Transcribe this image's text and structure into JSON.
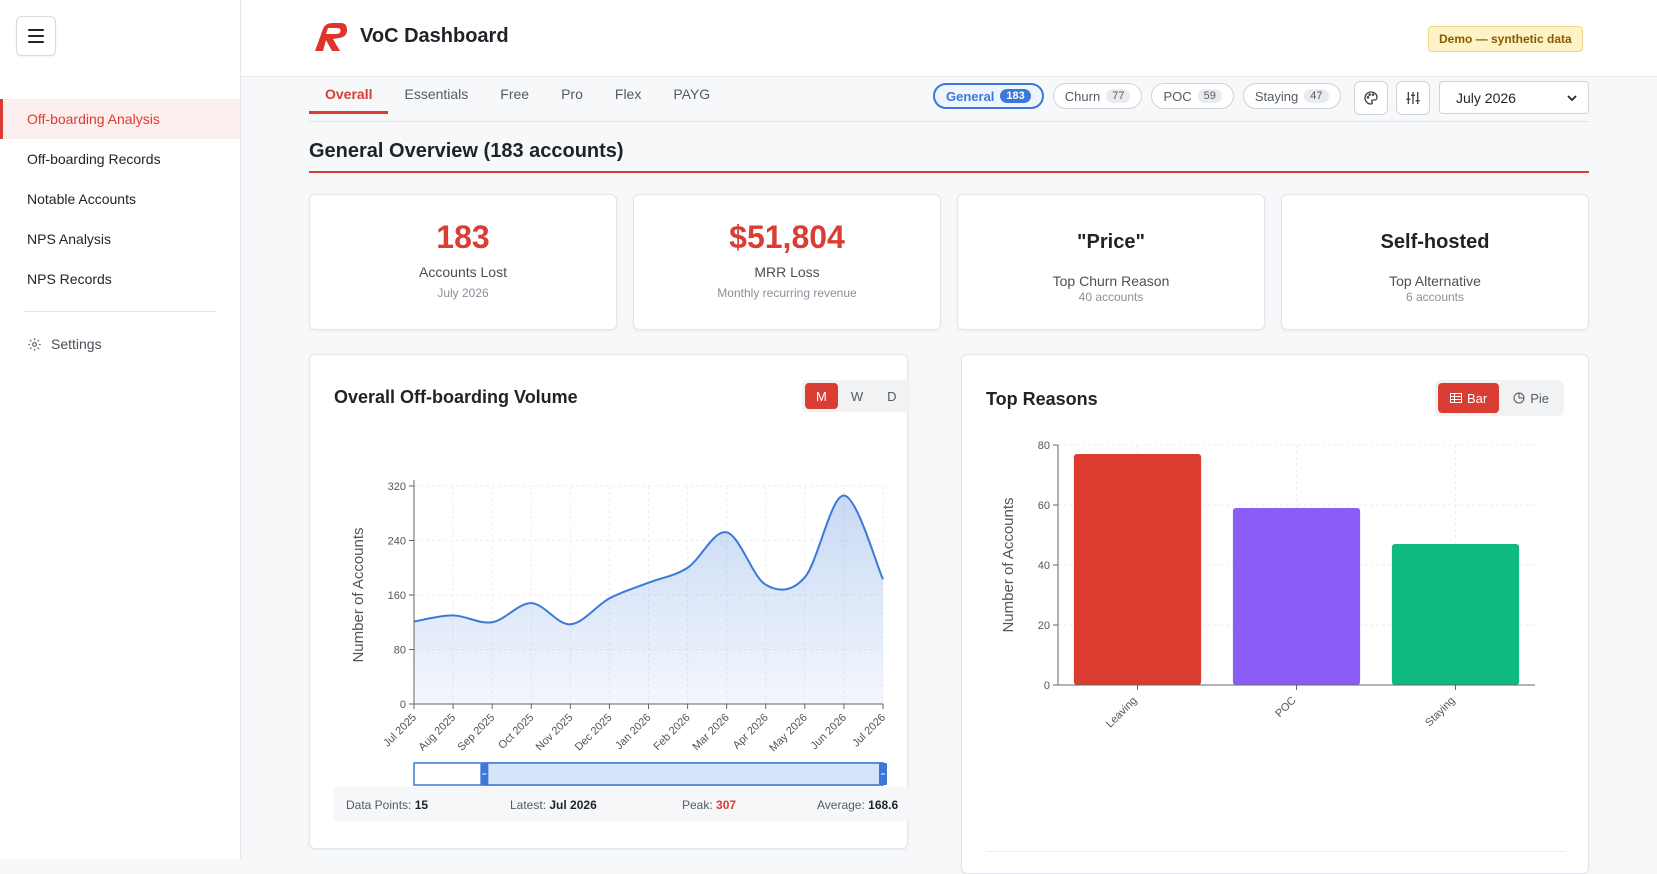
{
  "app": {
    "title": "VoC Dashboard",
    "demo_badge": "Demo — synthetic data"
  },
  "sidebar": {
    "items": [
      {
        "label": "Off-boarding Analysis",
        "active": true
      },
      {
        "label": "Off-boarding Records"
      },
      {
        "label": "Notable Accounts"
      },
      {
        "label": "NPS Analysis"
      },
      {
        "label": "NPS Records"
      }
    ],
    "settings_label": "Settings"
  },
  "tabs": [
    "Overall",
    "Essentials",
    "Free",
    "Pro",
    "Flex",
    "PAYG"
  ],
  "filters": [
    {
      "label": "General",
      "count": "183",
      "active": true
    },
    {
      "label": "Churn",
      "count": "77"
    },
    {
      "label": "POC",
      "count": "59"
    },
    {
      "label": "Staying",
      "count": "47"
    }
  ],
  "month_select": {
    "value": "July 2026"
  },
  "section": {
    "title": "General Overview (183 accounts)"
  },
  "kpis": [
    {
      "value": "183",
      "label": "Accounts Lost",
      "sub": "July 2026"
    },
    {
      "value": "$51,804",
      "label": "MRR Loss",
      "sub": "Monthly recurring revenue"
    },
    {
      "value": "\"Price\"",
      "label": "Top Churn Reason",
      "sub": "40 accounts"
    },
    {
      "value": "Self-hosted",
      "label": "Top Alternative",
      "sub": "6 accounts"
    }
  ],
  "volume_card": {
    "title": "Overall Off-boarding Volume",
    "granularity": [
      "M",
      "W",
      "D"
    ],
    "stats": {
      "data_points_label": "Data Points:",
      "data_points": "15",
      "latest_label": "Latest:",
      "latest": "Jul 2026",
      "peak_label": "Peak:",
      "peak": "307",
      "average_label": "Average:",
      "average": "168.6"
    }
  },
  "reasons_card": {
    "title": "Top Reasons",
    "toggle": [
      "Bar",
      "Pie"
    ]
  },
  "colors": {
    "accent": "#d93d33",
    "blue": "#3b78d8",
    "purple": "#8b5cf6",
    "green": "#10b981"
  },
  "chart_data": [
    {
      "type": "area",
      "ylabel": "Number of Accounts",
      "ylim": [
        0,
        320
      ],
      "yticks": [
        0,
        80,
        160,
        240,
        320
      ],
      "x": [
        "Jul 2025",
        "Aug 2025",
        "Sep 2025",
        "Oct 2025",
        "Nov 2025",
        "Dec 2025",
        "Jan 2026",
        "Feb 2026",
        "Mar 2026",
        "Apr 2026",
        "May 2026",
        "Jun 2026",
        "Jul 2026"
      ],
      "values": [
        121,
        130,
        120,
        148,
        117,
        155,
        178,
        200,
        252,
        175,
        186,
        306,
        183
      ],
      "grid": true,
      "range_slider": [
        0.15,
        1.0
      ]
    },
    {
      "type": "bar",
      "ylabel": "Number of Accounts",
      "ylim": [
        0,
        80
      ],
      "yticks": [
        0,
        20,
        40,
        60,
        80
      ],
      "categories": [
        "Leaving",
        "POC",
        "Staying"
      ],
      "values": [
        77,
        59,
        47
      ],
      "colors": [
        "#dc3b30",
        "#8b5cf6",
        "#10b981"
      ],
      "grid": true
    }
  ]
}
